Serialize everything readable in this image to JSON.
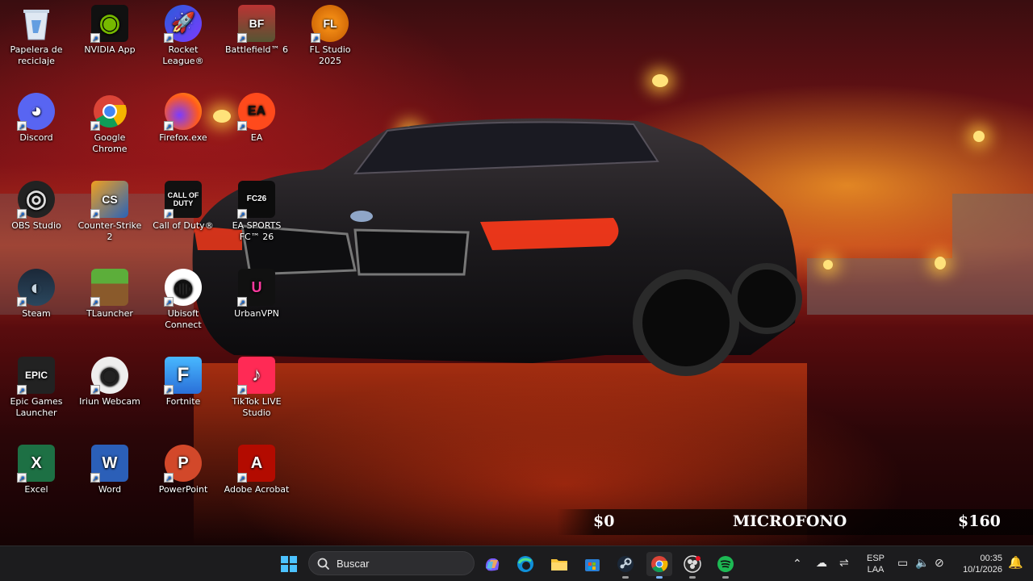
{
  "desktop": {
    "icons": [
      {
        "label": "Papelera de reciclaje",
        "icon": "recycle-bin-icon"
      },
      {
        "label": "NVIDIA App",
        "icon": "nvidia-icon"
      },
      {
        "label": "Rocket League®",
        "icon": "rocket-league-icon"
      },
      {
        "label": "Battlefield™ 6",
        "icon": "battlefield-icon"
      },
      {
        "label": "FL Studio 2025",
        "icon": "fl-studio-icon"
      },
      {
        "label": "Discord",
        "icon": "discord-icon"
      },
      {
        "label": "Google Chrome",
        "icon": "chrome-icon"
      },
      {
        "label": "Firefox.exe",
        "icon": "firefox-icon"
      },
      {
        "label": "EA",
        "icon": "ea-icon"
      },
      {
        "label": "OBS Studio",
        "icon": "obs-icon"
      },
      {
        "label": "Counter-Strike 2",
        "icon": "counter-strike-icon"
      },
      {
        "label": "Call of Duty®",
        "icon": "call-of-duty-icon"
      },
      {
        "label": "EA SPORTS FC™ 26",
        "icon": "ea-sports-fc-icon"
      },
      {
        "label": "Steam",
        "icon": "steam-icon"
      },
      {
        "label": "TLauncher",
        "icon": "tlauncher-icon"
      },
      {
        "label": "Ubisoft Connect",
        "icon": "ubisoft-icon"
      },
      {
        "label": "UrbanVPN",
        "icon": "urbanvpn-icon"
      },
      {
        "label": "Epic Games Launcher",
        "icon": "epic-games-icon"
      },
      {
        "label": "Iriun Webcam",
        "icon": "iriun-webcam-icon"
      },
      {
        "label": "Fortnite",
        "icon": "fortnite-icon"
      },
      {
        "label": "TikTok LIVE Studio",
        "icon": "tiktok-live-icon"
      },
      {
        "label": "Excel",
        "icon": "excel-icon"
      },
      {
        "label": "Word",
        "icon": "word-icon"
      },
      {
        "label": "PowerPoint",
        "icon": "powerpoint-icon"
      },
      {
        "label": "Adobe Acrobat",
        "icon": "adobe-acrobat-icon"
      }
    ],
    "glyphs": {
      "nvidia": "◉",
      "rocket": "🚀",
      "battlefield": "BF",
      "fl": "FL",
      "discord": "◕",
      "ea": "EA",
      "obs": "◎",
      "cs": "CS",
      "cod": "CALL OF DUTY",
      "fc": "FC26",
      "steam": "◐",
      "ubisoft": "◍",
      "urban": "U",
      "epic": "EPIC",
      "iriun": "◉",
      "fortnite": "F",
      "tiktok": "♪",
      "excel": "X",
      "word": "W",
      "ppt": "P",
      "acrobat": "A"
    }
  },
  "overlay": {
    "left_amount": "$0",
    "title": "MICROFONO",
    "right_amount": "$160"
  },
  "taskbar": {
    "search_placeholder": "Buscar",
    "apps": [
      "copilot-icon",
      "edge-icon",
      "file-explorer-icon",
      "microsoft-store-icon",
      "steam-icon",
      "chrome-icon",
      "obs-icon",
      "spotify-icon"
    ],
    "tray": {
      "language_line1": "ESP",
      "language_line2": "LAA",
      "time": "00:35",
      "date": "10/1/2026"
    }
  },
  "colors": {
    "taskbar_bg": "#1c1c1e",
    "accent": "#0078d4"
  }
}
